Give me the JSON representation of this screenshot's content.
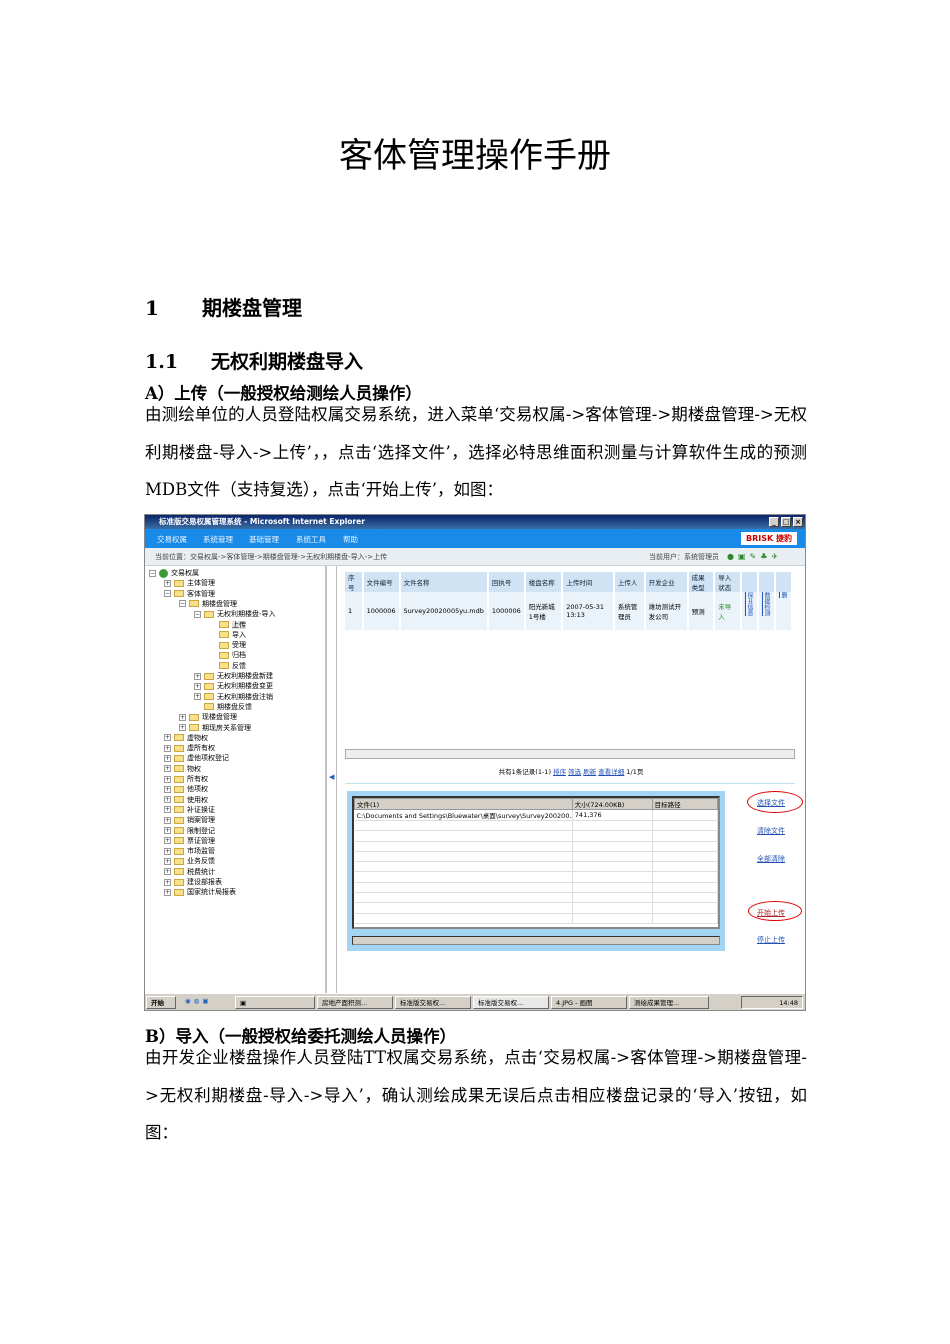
{
  "title": "客体管理操作手册",
  "section1": {
    "num": "1",
    "label": "期楼盘管理"
  },
  "section11": {
    "num": "1.1",
    "label": "无权利期楼盘导入"
  },
  "partA": {
    "heading": "A）上传（一般授权给测绘人员操作）",
    "text": "由测绘单位的人员登陆权属交易系统，进入菜单‘交易权属->客体管理->期楼盘管理->无权利期楼盘-导入->上传’，，点击‘选择文件’，选择必特思维面积测量与计算软件生成的预测MDB文件（支持复选），点击‘开始上传’，如图："
  },
  "partB": {
    "heading": "B）导入（一般授权给委托测绘人员操作）",
    "text": "由开发企业楼盘操作人员登陆TT权属交易系统，点击‘交易权属->客体管理->期楼盘管理->无权利期楼盘-导入->导入’，确认测绘成果无误后点击相应楼盘记录的‘导入’按钮，如图："
  },
  "screenshot": {
    "window_title": "标准版交易权属管理系统 - Microsoft Internet Explorer",
    "menu": [
      "交易权属",
      "系统管理",
      "基础管理",
      "系统工具",
      "帮助"
    ],
    "brand": "BRISK 捷豹",
    "breadcrumb": "当前位置：交易权属->客体管理->期楼盘管理->无权利期楼盘-导入->上传",
    "current_user": "当前用户：系统管理员",
    "tree": [
      "交易权属",
      "主体管理",
      "客体管理",
      "期楼盘管理",
      "无权利期楼盘-导入",
      "上传",
      "导入",
      "受理",
      "归档",
      "反馈",
      "无权利期楼盘新建",
      "无权利期楼盘变更",
      "无权利期楼盘注销",
      "期楼盘反馈",
      "现楼盘管理",
      "期现房关系管理",
      "虚物权",
      "虚所有权",
      "虚他项权登记",
      "物权",
      "所有权",
      "他项权",
      "使用权",
      "补证换证",
      "销案管理",
      "限制登记",
      "票证管理",
      "市场监管",
      "业务反馈",
      "税费统计",
      "建设部报表",
      "国家统计局报表"
    ],
    "grid_headers": [
      "序号",
      "文件编号",
      "文件名称",
      "回执号",
      "楼盘名称",
      "上传时间",
      "上传人",
      "开发企业",
      "成果类型",
      "导入状态",
      "",
      "",
      ""
    ],
    "grid_row": [
      "1",
      "1000006",
      "Survey20020005yu.mdb",
      "1000006",
      "阳光新城1号楼",
      "2007-05-31 13:13",
      "系统管理员",
      "潍坊测试开发公司",
      "预测",
      "未导入",
      "探표信息",
      "数据检测",
      "删"
    ],
    "pager": {
      "summary": "共有1条记录(1-1)",
      "links": [
        "排序",
        "筛选",
        "刷新",
        "查看详细"
      ],
      "page": "1/1页"
    },
    "file_headers": [
      "文件(1)",
      "大小(724.00KB)",
      "目标路径"
    ],
    "file_row": [
      "C:\\Documents and Settings\\Bluewater\\桌面\\survey\\Survey200200...",
      "741,376",
      ""
    ],
    "actions": [
      "选择文件",
      "清除文件",
      "全部清除",
      "开始上传",
      "停止上传"
    ],
    "taskbar": {
      "start": "开始",
      "items": [
        "房地产面积测...",
        "标准版交易权...",
        "标准版交易权...",
        "4.JPG - 画图",
        "测绘成果管理..."
      ],
      "clock": "14:48"
    },
    "colors": {
      "menu": "#1a8ae8",
      "highlight_ring": "#dd0000",
      "status_green": "#2a8a2a"
    }
  }
}
